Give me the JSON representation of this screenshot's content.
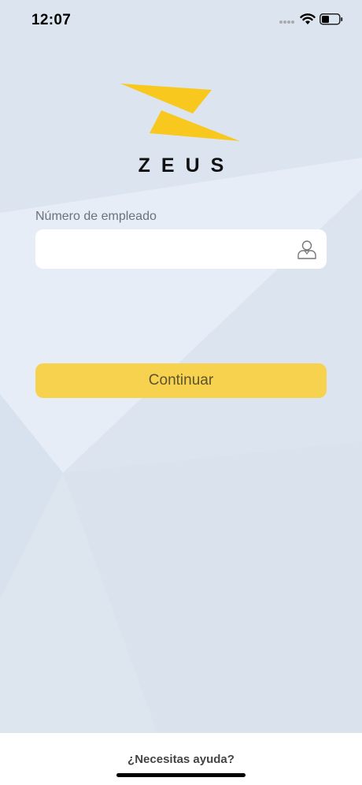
{
  "status_bar": {
    "time": "12:07",
    "icons": [
      "signal-icon",
      "wifi-icon",
      "battery-icon"
    ]
  },
  "brand": {
    "name": "ZEUS",
    "logo_color": "#f9c81e",
    "logo_icon": "lightning-z-logo"
  },
  "login": {
    "employee_label": "Número de empleado",
    "employee_value": "",
    "employee_placeholder": "",
    "field_icon": "user-icon",
    "continue_label": "Continuar",
    "button_color": "#f6d24f"
  },
  "footer": {
    "help_label": "¿Necesitas ayuda?"
  }
}
